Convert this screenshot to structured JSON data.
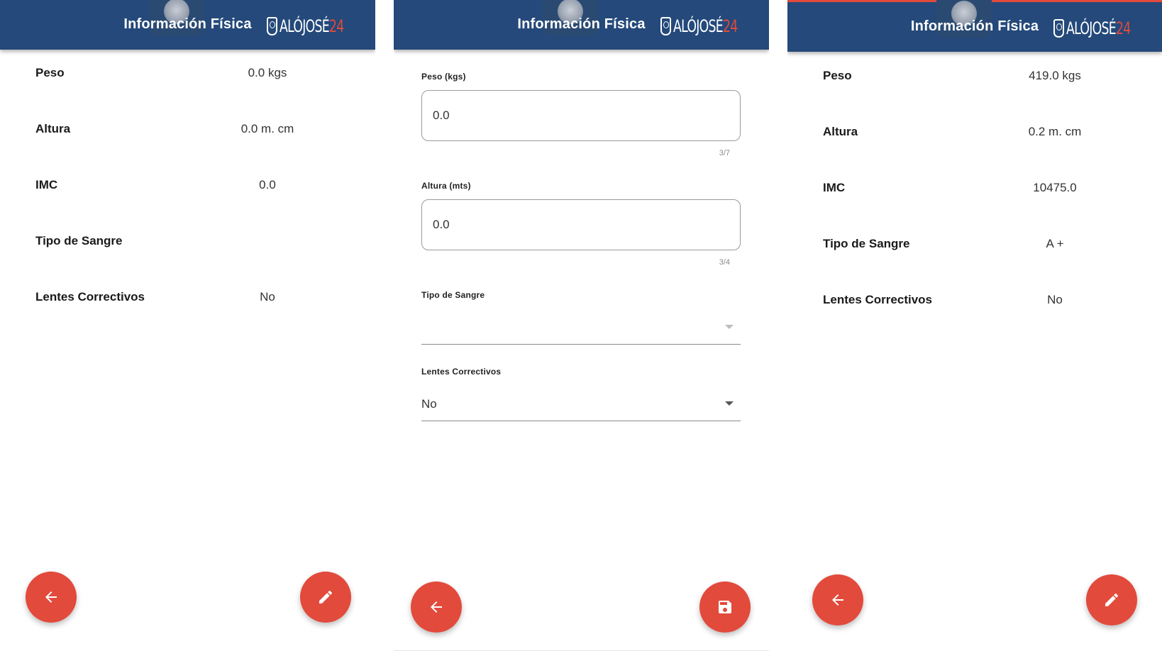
{
  "app": {
    "title": "Información Física",
    "logo_text": "ALÓJOSÉ",
    "logo_number": "24",
    "colors": {
      "appbar": "#24497a",
      "accent": "#e24a3c"
    }
  },
  "view_screen_1": {
    "rows": [
      {
        "label": "Peso",
        "value": "0.0 kgs"
      },
      {
        "label": "Altura",
        "value": "0.0 m. cm"
      },
      {
        "label": "IMC",
        "value": "0.0"
      },
      {
        "label": "Tipo de Sangre",
        "value": ""
      },
      {
        "label": "Lentes Correctivos",
        "value": "No"
      }
    ],
    "back_icon": "arrow-left-icon",
    "edit_icon": "pencil-icon"
  },
  "edit_screen": {
    "peso": {
      "label": "Peso (kgs)",
      "value": "0.0",
      "counter": "3/7"
    },
    "altura": {
      "label": "Altura (mts)",
      "value": "0.0",
      "counter": "3/4"
    },
    "tipo_sangre": {
      "label": "Tipo de Sangre",
      "value": ""
    },
    "lentes": {
      "label": "Lentes Correctivos",
      "value": "No"
    },
    "back_icon": "arrow-left-icon",
    "save_icon": "floppy-disk-icon"
  },
  "view_screen_2": {
    "rows": [
      {
        "label": "Peso",
        "value": "419.0 kgs"
      },
      {
        "label": "Altura",
        "value": "0.2 m. cm"
      },
      {
        "label": "IMC",
        "value": "10475.0"
      },
      {
        "label": "Tipo de Sangre",
        "value": "A +"
      },
      {
        "label": "Lentes Correctivos",
        "value": "No"
      }
    ],
    "back_icon": "arrow-left-icon",
    "edit_icon": "pencil-icon"
  }
}
